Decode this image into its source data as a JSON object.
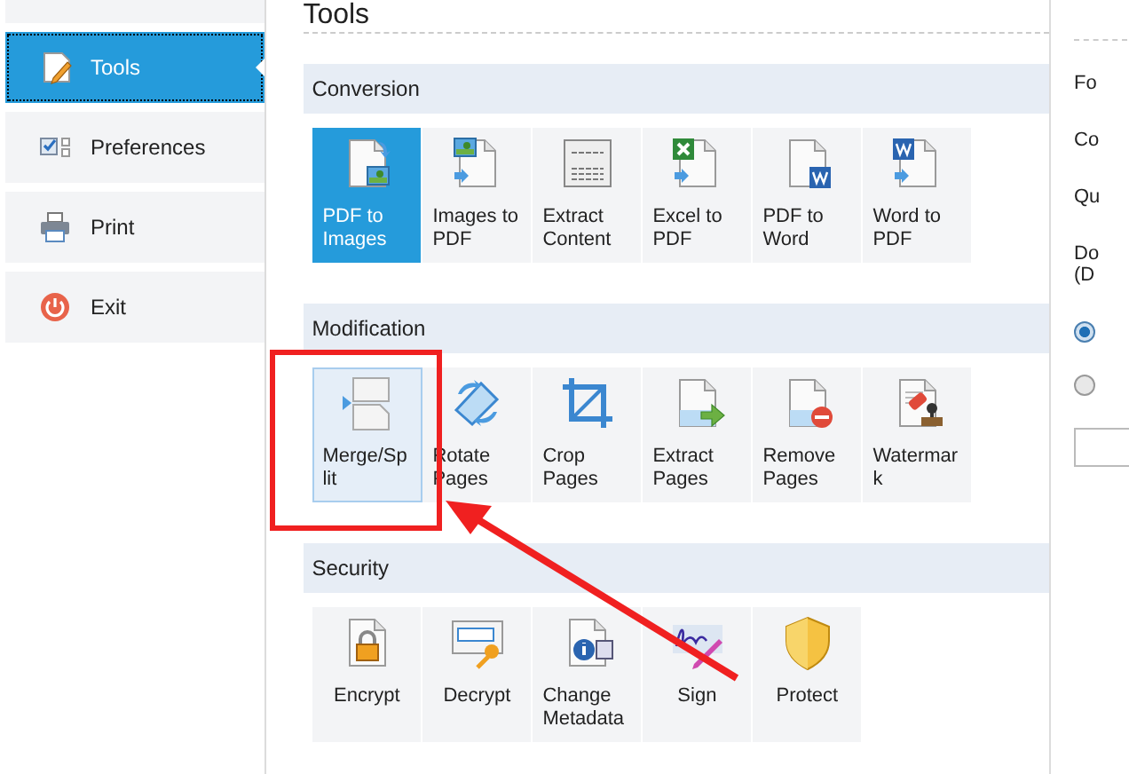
{
  "sidebar": {
    "items": [
      {
        "label": "Tools",
        "selected": true
      },
      {
        "label": "Preferences",
        "selected": false
      },
      {
        "label": "Print",
        "selected": false
      },
      {
        "label": "Exit",
        "selected": false
      }
    ]
  },
  "title": "Tools",
  "sections": [
    {
      "title": "Conversion",
      "tools": [
        {
          "label": "PDF to Images",
          "selected": true,
          "hovered": false
        },
        {
          "label": "Images to PDF",
          "selected": false,
          "hovered": false
        },
        {
          "label": "Extract Content",
          "selected": false,
          "hovered": false
        },
        {
          "label": "Excel to PDF",
          "selected": false,
          "hovered": false
        },
        {
          "label": "PDF to Word",
          "selected": false,
          "hovered": false
        },
        {
          "label": "Word to PDF",
          "selected": false,
          "hovered": false
        }
      ]
    },
    {
      "title": "Modification",
      "tools": [
        {
          "label": "Merge/Split",
          "selected": false,
          "hovered": true
        },
        {
          "label": "Rotate Pages",
          "selected": false,
          "hovered": false
        },
        {
          "label": "Crop Pages",
          "selected": false,
          "hovered": false
        },
        {
          "label": "Extract Pages",
          "selected": false,
          "hovered": false
        },
        {
          "label": "Remove Pages",
          "selected": false,
          "hovered": false
        },
        {
          "label": "Watermark",
          "selected": false,
          "hovered": false
        }
      ]
    },
    {
      "title": "Security",
      "tools": [
        {
          "label": "Encrypt",
          "selected": false,
          "hovered": false
        },
        {
          "label": "Decrypt",
          "selected": false,
          "hovered": false
        },
        {
          "label": "Change Metadata",
          "selected": false,
          "hovered": false
        },
        {
          "label": "Sign",
          "selected": false,
          "hovered": false
        },
        {
          "label": "Protect",
          "selected": false,
          "hovered": false
        }
      ]
    }
  ],
  "settings": {
    "labels": [
      "Fo",
      "Co",
      "Qu",
      "Do\n(D"
    ],
    "radios": [
      {
        "selected": true
      },
      {
        "selected": false
      }
    ]
  }
}
